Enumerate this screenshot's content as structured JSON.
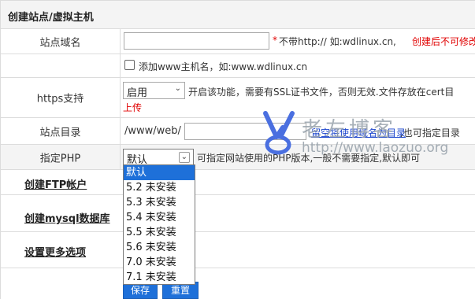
{
  "form": {
    "title": "创建站点/虚拟主机",
    "domain": {
      "label": "站点域名",
      "value": "",
      "hint_star": "*",
      "hint": "不带http:// 如:wdlinux.cn,",
      "hint_red": "创建后不可修改"
    },
    "www": {
      "checked": false,
      "label": "添加www主机名，如:www.wdlinux.cn"
    },
    "https": {
      "label": "https支持",
      "selected": "启用",
      "hint": "开启该功能，需要有SSL证书文件，否则无效.文件存放在cert目",
      "hint_link": "上传"
    },
    "directory": {
      "label": "站点目录",
      "prefix": "/www/web/",
      "value": "",
      "hint_blue": "留空将使用域名为目录",
      "hint_tail": ",也可指定目录"
    },
    "php": {
      "label": "指定PHP",
      "selected": "默认",
      "hint": "可指定网站使用的PHP版本,一般不需要指定,默认即可",
      "options": [
        "默认",
        "5.2 未安装",
        "5.3 未安装",
        "5.4 未安装",
        "5.5 未安装",
        "5.6 未安装",
        "7.0 未安装",
        "7.1 未安装"
      ]
    },
    "sections": {
      "ftp": "创建FTP帐户",
      "mysql": "创建mysql数据库",
      "more": "设置更多选项"
    },
    "buttons": {
      "save": "保存",
      "reset": "重置"
    }
  },
  "watermark": {
    "title": "老左博客",
    "url": "http://www.laozuo.org"
  },
  "colors": {
    "accent": "#1e70d9",
    "warning": "#e00000",
    "link": "#1a44cc"
  }
}
